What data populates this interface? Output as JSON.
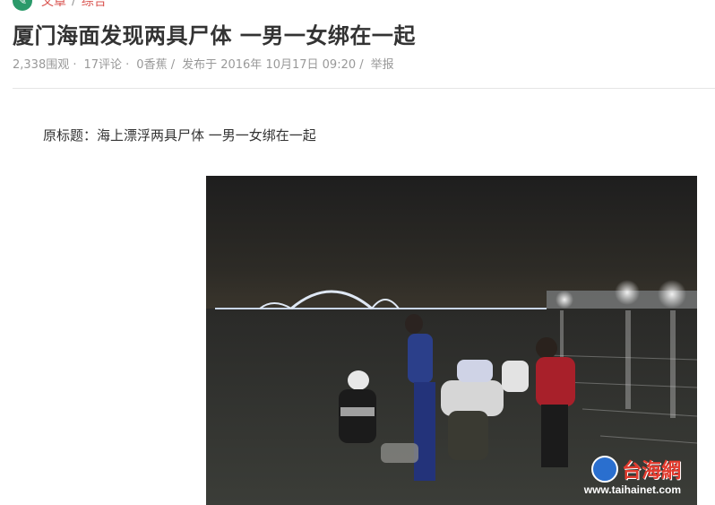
{
  "breadcrumb": {
    "section": "文章",
    "category": "综合",
    "separator": "/"
  },
  "article": {
    "title": "厦门海面发现两具尸体 一男一女绑在一起",
    "meta": {
      "views": "2,338围观 ·",
      "comments": "17评论 ·",
      "bananas": "0香蕉 /",
      "published": "发布于 2016年 10月17日 09:20 /",
      "report": "举报"
    },
    "original_title": "原标题：海上漂浮两具尸体 一男一女绑在一起"
  },
  "photo": {
    "watermark_name": "台海網",
    "watermark_url": "www.taihainet.com"
  },
  "colors": {
    "accent": "#d9534f",
    "icon_bg": "#2b9a6a"
  }
}
